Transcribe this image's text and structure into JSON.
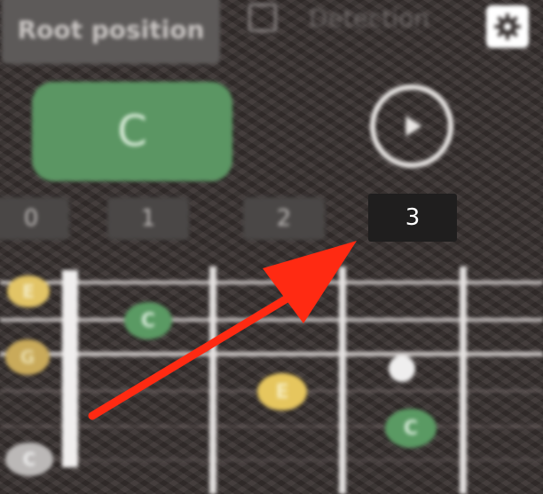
{
  "toolbar": {
    "mode_label": "Root position",
    "detection_label": "Detection",
    "detection_checked": false,
    "settings_icon": "gear-icon"
  },
  "chord": {
    "label": "C"
  },
  "play": {
    "icon": "play-icon"
  },
  "fret_numbers": [
    "0",
    "1",
    "2",
    "3"
  ],
  "highlighted_fret": "3",
  "open_strings": [
    "E",
    "G",
    "",
    "C"
  ],
  "notes": [
    {
      "label": "C",
      "fret": 1,
      "color": "#5a9a63"
    },
    {
      "label": "E",
      "fret": 2,
      "color": "#e6c65e"
    },
    {
      "label": "",
      "fret": 3,
      "color": "#efeeee"
    },
    {
      "label": "C",
      "fret": 3,
      "color": "#5a9a63"
    }
  ],
  "colors": {
    "root": "#5a9a63",
    "third": "#e6c65e",
    "annotation_arrow": "#ff2a12"
  }
}
